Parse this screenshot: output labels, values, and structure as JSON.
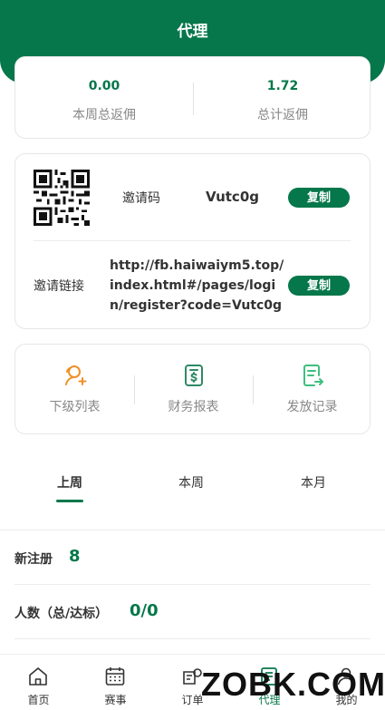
{
  "header": {
    "title": "代理"
  },
  "stats": {
    "week_commission_value": "0.00",
    "week_commission_label": "本周总返佣",
    "total_commission_value": "1.72",
    "total_commission_label": "总计返佣"
  },
  "invite": {
    "code_label": "邀请码",
    "code_value": "Vutc0g",
    "copy_label": "复制",
    "link_label": "邀请链接",
    "link_value": "http://fb.haiwaiym5.top/index.html#/pages/login/register?code=Vutc0g"
  },
  "menu": [
    {
      "label": "下级列表",
      "icon": "add-user-icon"
    },
    {
      "label": "财务报表",
      "icon": "finance-report-icon"
    },
    {
      "label": "发放记录",
      "icon": "issue-record-icon"
    }
  ],
  "tabs": [
    {
      "label": "上周",
      "active": true
    },
    {
      "label": "本周",
      "active": false
    },
    {
      "label": "本月",
      "active": false
    }
  ],
  "summary": {
    "new_register_label": "新注册",
    "new_register_value": "8",
    "people_label": "人数（总/达标）",
    "people_value": "0/0"
  },
  "bottom_nav": [
    {
      "label": "首页",
      "icon": "home-icon"
    },
    {
      "label": "赛事",
      "icon": "calendar-icon"
    },
    {
      "label": "订单",
      "icon": "order-icon"
    },
    {
      "label": "代理",
      "icon": "agent-icon",
      "active": true
    },
    {
      "label": "我的",
      "icon": "profile-icon"
    }
  ],
  "watermark": "ZOBK.COM",
  "colors": {
    "brand_green": "#05774a",
    "menu_orange": "#f0902a",
    "menu_teal": "#2e8a66",
    "menu_light_green": "#3fbf7f"
  }
}
